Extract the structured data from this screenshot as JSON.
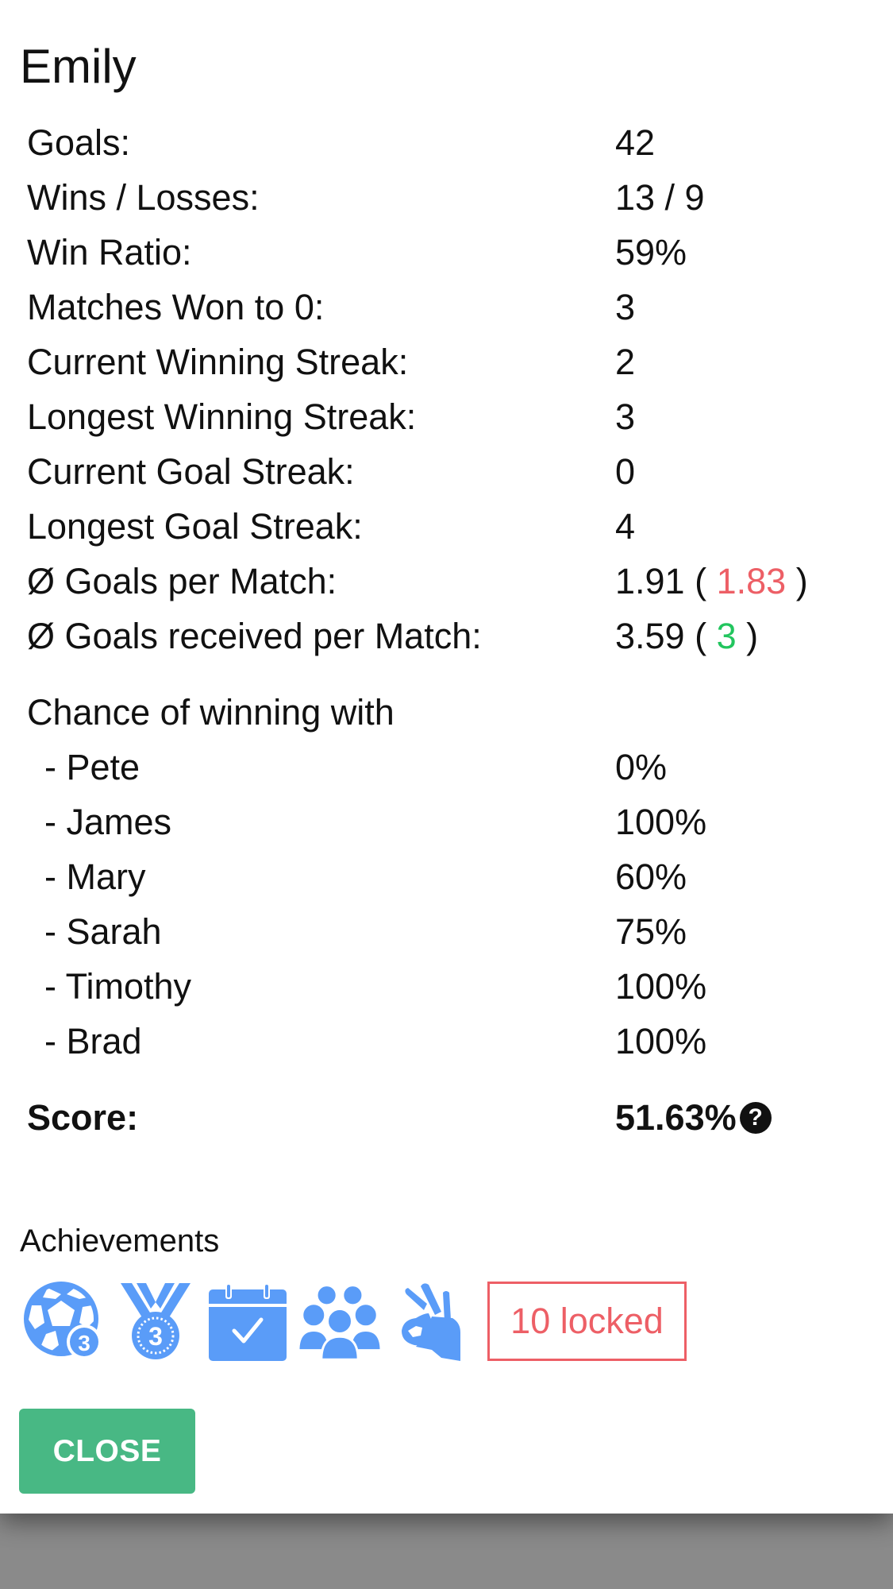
{
  "player": {
    "name": "Emily"
  },
  "stats": [
    {
      "label": "Goals:",
      "value": "42"
    },
    {
      "label": "Wins / Losses:",
      "value": "13 / 9"
    },
    {
      "label": "Win Ratio:",
      "value": "59%"
    },
    {
      "label": "Matches Won to 0:",
      "value": "3"
    },
    {
      "label": "Current Winning Streak:",
      "value": "2"
    },
    {
      "label": "Longest Winning Streak:",
      "value": "3"
    },
    {
      "label": "Current Goal Streak:",
      "value": "0"
    },
    {
      "label": "Longest Goal Streak:",
      "value": "4"
    }
  ],
  "averages": {
    "goals_per_match": {
      "label": "Ø Goals per Match:",
      "value": "1.91",
      "open": "(",
      "compare": "1.83",
      "compare_color": "#ed5f66",
      "close": ")"
    },
    "goals_received_per_match": {
      "label": "Ø Goals received per Match:",
      "value": "3.59",
      "open": "(",
      "compare": "3",
      "compare_color": "#22c55e",
      "close": ")"
    }
  },
  "chance": {
    "heading": "Chance of winning with",
    "partners": [
      {
        "label": "- Pete",
        "value": "0%"
      },
      {
        "label": "- James",
        "value": "100%"
      },
      {
        "label": "- Mary",
        "value": "60%"
      },
      {
        "label": "- Sarah",
        "value": "75%"
      },
      {
        "label": "- Timothy",
        "value": "100%"
      },
      {
        "label": "- Brad",
        "value": "100%"
      }
    ]
  },
  "score": {
    "label": "Score:",
    "value": "51.63%",
    "help_icon": "question-circle-icon",
    "help_glyph": "?"
  },
  "achievements": {
    "title": "Achievements",
    "icon_color": "#5a9cf8",
    "items": [
      {
        "icon": "soccer-ball-3-icon",
        "badge": "3"
      },
      {
        "icon": "bronze-medal-3-icon",
        "badge": "3"
      },
      {
        "icon": "calendar-check-icon"
      },
      {
        "icon": "group-people-icon"
      },
      {
        "icon": "ok-hand-icon"
      }
    ],
    "locked_label": "10 locked",
    "locked_color": "#ed5f66"
  },
  "actions": {
    "close_label": "CLOSE",
    "close_color": "#48b884"
  }
}
